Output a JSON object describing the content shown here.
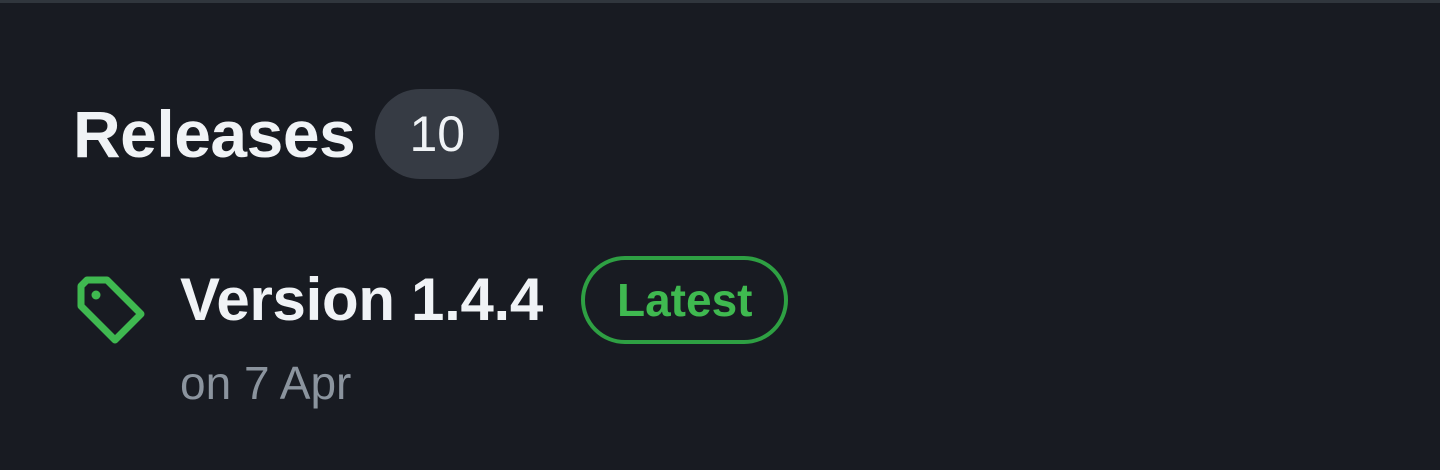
{
  "releases": {
    "title": "Releases",
    "count": "10",
    "latest": {
      "name": "Version 1.4.4",
      "badge": "Latest",
      "date": "on 7 Apr"
    }
  },
  "colors": {
    "background": "#181b22",
    "accent_green": "#3fb950",
    "muted_text": "#8b949e"
  },
  "icons": {
    "release_tag": "tag-icon"
  }
}
